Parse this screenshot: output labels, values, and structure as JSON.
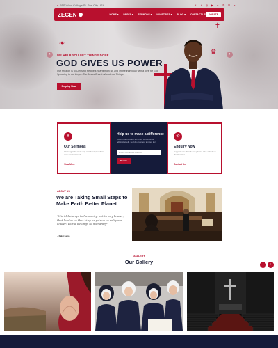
{
  "topbar": {
    "address": "55S Ward Collage St. Sun City USA",
    "social_icons": [
      "facebook-icon",
      "twitter-icon",
      "instagram-icon",
      "youtube-icon",
      "play-icon",
      "phone-icon",
      "mail-icon",
      "search-icon"
    ]
  },
  "header": {
    "logo_text": "ZEGEN",
    "nav": [
      "HOME ▾",
      "PAGES ▾",
      "SERMONS ▾",
      "MINISTRIES ▾",
      "BLOG ▾",
      "CONTACT US"
    ],
    "donate_label": "DONATE"
  },
  "hero": {
    "kicker": "WE HELP YOU GET THINGS DONE",
    "title": "GOD GIVES US POWER",
    "description": "Our Mission is to Clensing People's hearts from sin and lift the individual with a love for God Speaking to our Zegen The Jesus Church Wonderful Things",
    "cta_label": "Enquiry Now"
  },
  "features": {
    "left": {
      "title": "Our Sermons",
      "text": "We taught the truth any which ways and we are excellent mode",
      "link": "View More"
    },
    "middle": {
      "title": "Help us to make a difference",
      "text": "Lorem ipsum dolor sit amet, consectetur adipiscing elit, sed do eiusmod tempor inci",
      "input_placeholder": "Enter Your Email Address",
      "button_label": "Donate"
    },
    "right": {
      "title": "Enquiry Now",
      "text": "Support our church and please take a look on the Updates",
      "link": "Contact Us"
    }
  },
  "about": {
    "kicker": "ABOUT US",
    "title": "We are Taking Small Steps to Make Earth Better Planet",
    "quote": "\"World belongs to humanity, not to any leader, that leader or that king or prince or religious leader. World belongs to humanity\"",
    "author": "~ Dalai Lama"
  },
  "gallery": {
    "kicker": "GALLERY",
    "title": "Our Gallery",
    "prev_icon": "chevron-left-icon",
    "next_icon": "chevron-right-icon"
  },
  "colors": {
    "accent": "#b8102e",
    "navy": "#151b3a"
  }
}
